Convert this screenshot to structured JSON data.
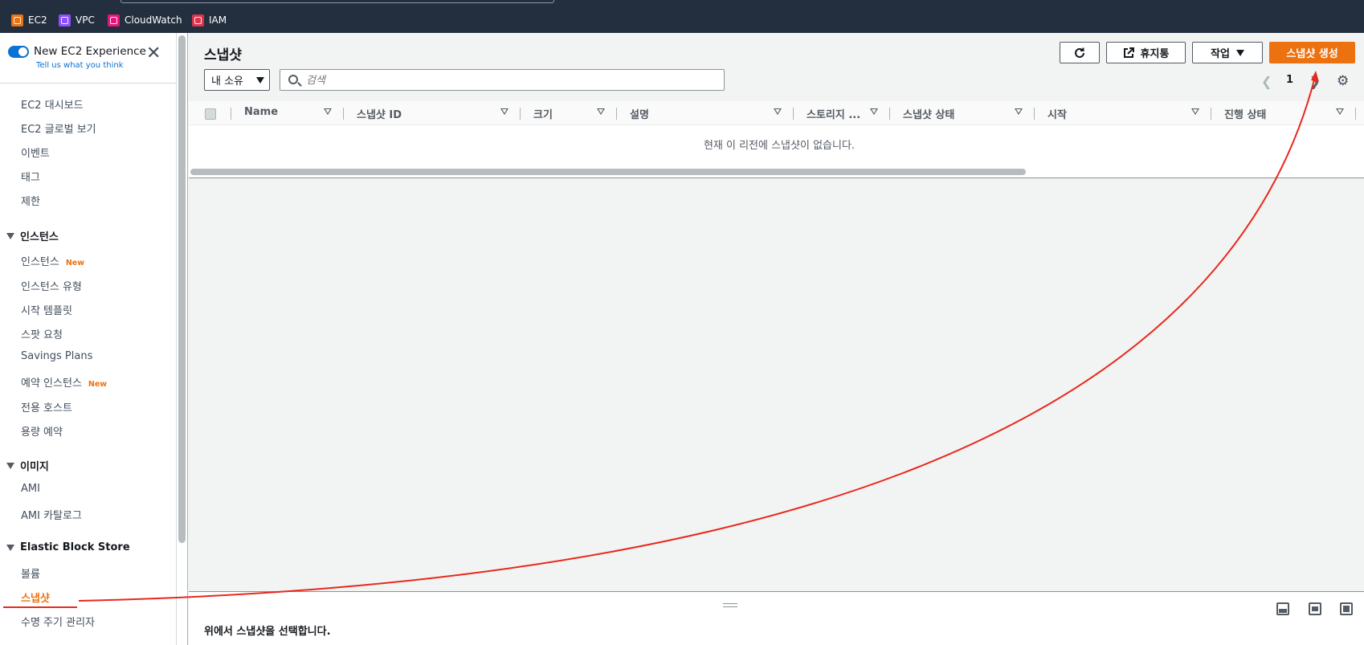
{
  "favorites": [
    {
      "label": "EC2",
      "icon": "ec2-icon",
      "color": "#ec7211"
    },
    {
      "label": "VPC",
      "icon": "vpc-icon",
      "color": "#8c4fff"
    },
    {
      "label": "CloudWatch",
      "icon": "cloudwatch-icon",
      "color": "#e7157b"
    },
    {
      "label": "IAM",
      "icon": "iam-icon",
      "color": "#dd344c"
    }
  ],
  "sidebar": {
    "new_experience": "New EC2 Experience",
    "feedback_link": "Tell us what you think",
    "top_items": [
      "EC2 대시보드",
      "EC2 글로벌 보기",
      "이벤트",
      "태그",
      "제한"
    ],
    "sections": [
      {
        "title": "인스턴스",
        "items": [
          {
            "label": "인스턴스",
            "badge": "New"
          },
          {
            "label": "인스턴스 유형"
          },
          {
            "label": "시작 템플릿"
          },
          {
            "label": "스팟 요청"
          },
          {
            "label": "Savings Plans"
          },
          {
            "label": "예약 인스턴스",
            "badge": "New"
          },
          {
            "label": "전용 호스트"
          },
          {
            "label": "용량 예약"
          }
        ]
      },
      {
        "title": "이미지",
        "items": [
          {
            "label": "AMI"
          },
          {
            "label": "AMI 카탈로그"
          }
        ]
      },
      {
        "title": "Elastic Block Store",
        "items": [
          {
            "label": "볼륨"
          },
          {
            "label": "스냅샷",
            "active": true
          },
          {
            "label": "수명 주기 관리자"
          }
        ]
      }
    ]
  },
  "main": {
    "title": "스냅샷",
    "recycle_bin_label": "휴지통",
    "actions_label": "작업",
    "create_label": "스냅샷 생성",
    "owner_filter": "내 소유",
    "search_placeholder": "검색",
    "page_number": "1",
    "columns": [
      "Name",
      "스냅샷 ID",
      "크기",
      "설명",
      "스토리지 ...",
      "스냅샷 상태",
      "시작",
      "진행 상태"
    ],
    "empty_message": "현재 이 리전에 스냅샷이 없습니다.",
    "split_message": "위에서 스냅샷을 선택합니다."
  },
  "colors": {
    "accent": "#ec7211",
    "link": "#0972d3",
    "annotation": "#e8281d"
  }
}
